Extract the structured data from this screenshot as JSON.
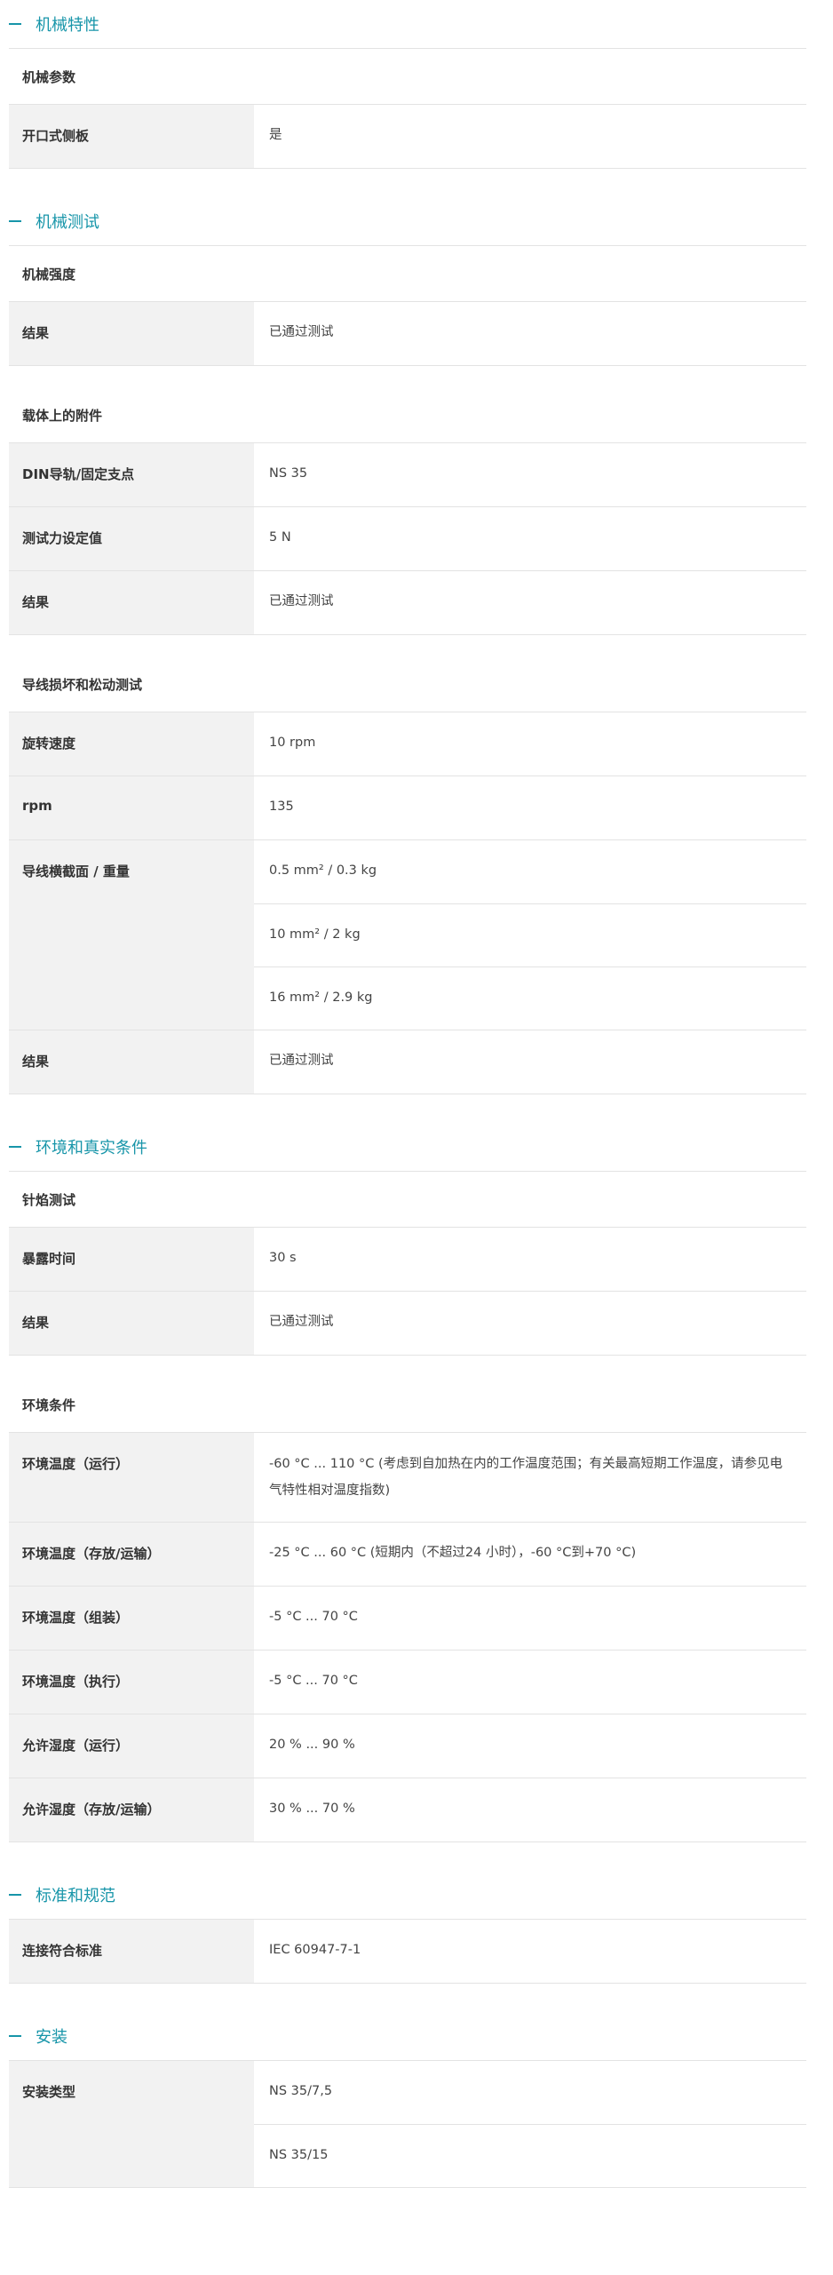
{
  "sections": [
    {
      "title": "机械特性",
      "groups": [
        {
          "title": "机械参数",
          "rows": [
            {
              "label": "开口式侧板",
              "values": [
                "是"
              ]
            }
          ]
        }
      ]
    },
    {
      "title": "机械测试",
      "groups": [
        {
          "title": "机械强度",
          "rows": [
            {
              "label": "结果",
              "values": [
                "已通过测试"
              ]
            }
          ]
        },
        {
          "title": "载体上的附件",
          "rows": [
            {
              "label": "DIN导轨/固定支点",
              "values": [
                "NS 35"
              ]
            },
            {
              "label": "测试力设定值",
              "values": [
                "5 N"
              ]
            },
            {
              "label": "结果",
              "values": [
                "已通过测试"
              ]
            }
          ]
        },
        {
          "title": "导线损坏和松动测试",
          "rows": [
            {
              "label": "旋转速度",
              "values": [
                "10 rpm"
              ]
            },
            {
              "label": "rpm",
              "values": [
                "135"
              ]
            },
            {
              "label": "导线横截面 / 重量",
              "values": [
                "0.5 mm² / 0.3 kg",
                "10 mm² / 2 kg",
                "16 mm² / 2.9 kg"
              ]
            },
            {
              "label": "结果",
              "values": [
                "已通过测试"
              ]
            }
          ]
        }
      ]
    },
    {
      "title": "环境和真实条件",
      "groups": [
        {
          "title": "针焰测试",
          "rows": [
            {
              "label": "暴露时间",
              "values": [
                "30 s"
              ]
            },
            {
              "label": "结果",
              "values": [
                "已通过测试"
              ]
            }
          ]
        },
        {
          "title": "环境条件",
          "rows": [
            {
              "label": "环境温度（运行）",
              "values": [
                "-60 °C ... 110 °C (考虑到自加热在内的工作温度范围；有关最高短期工作温度，请参见电气特性相对温度指数)"
              ],
              "tall": true
            },
            {
              "label": "环境温度（存放/运输）",
              "values": [
                "-25 °C ... 60 °C (短期内（不超过24 小时），-60 °C到+70 °C)"
              ]
            },
            {
              "label": "环境温度（组装）",
              "values": [
                "-5 °C ... 70 °C"
              ]
            },
            {
              "label": "环境温度（执行）",
              "values": [
                "-5 °C ... 70 °C"
              ]
            },
            {
              "label": "允许湿度（运行）",
              "values": [
                "20 % ... 90 %"
              ]
            },
            {
              "label": "允许湿度（存放/运输）",
              "values": [
                "30 % ... 70 %"
              ]
            }
          ]
        }
      ]
    },
    {
      "title": "标准和规范",
      "groups": [
        {
          "title": "",
          "rows": [
            {
              "label": "连接符合标准",
              "values": [
                "IEC 60947-7-1"
              ]
            }
          ]
        }
      ]
    },
    {
      "title": "安装",
      "groups": [
        {
          "title": "",
          "rows": [
            {
              "label": "安装类型",
              "values": [
                "NS 35/7,5",
                "NS 35/15"
              ]
            }
          ]
        }
      ]
    }
  ]
}
